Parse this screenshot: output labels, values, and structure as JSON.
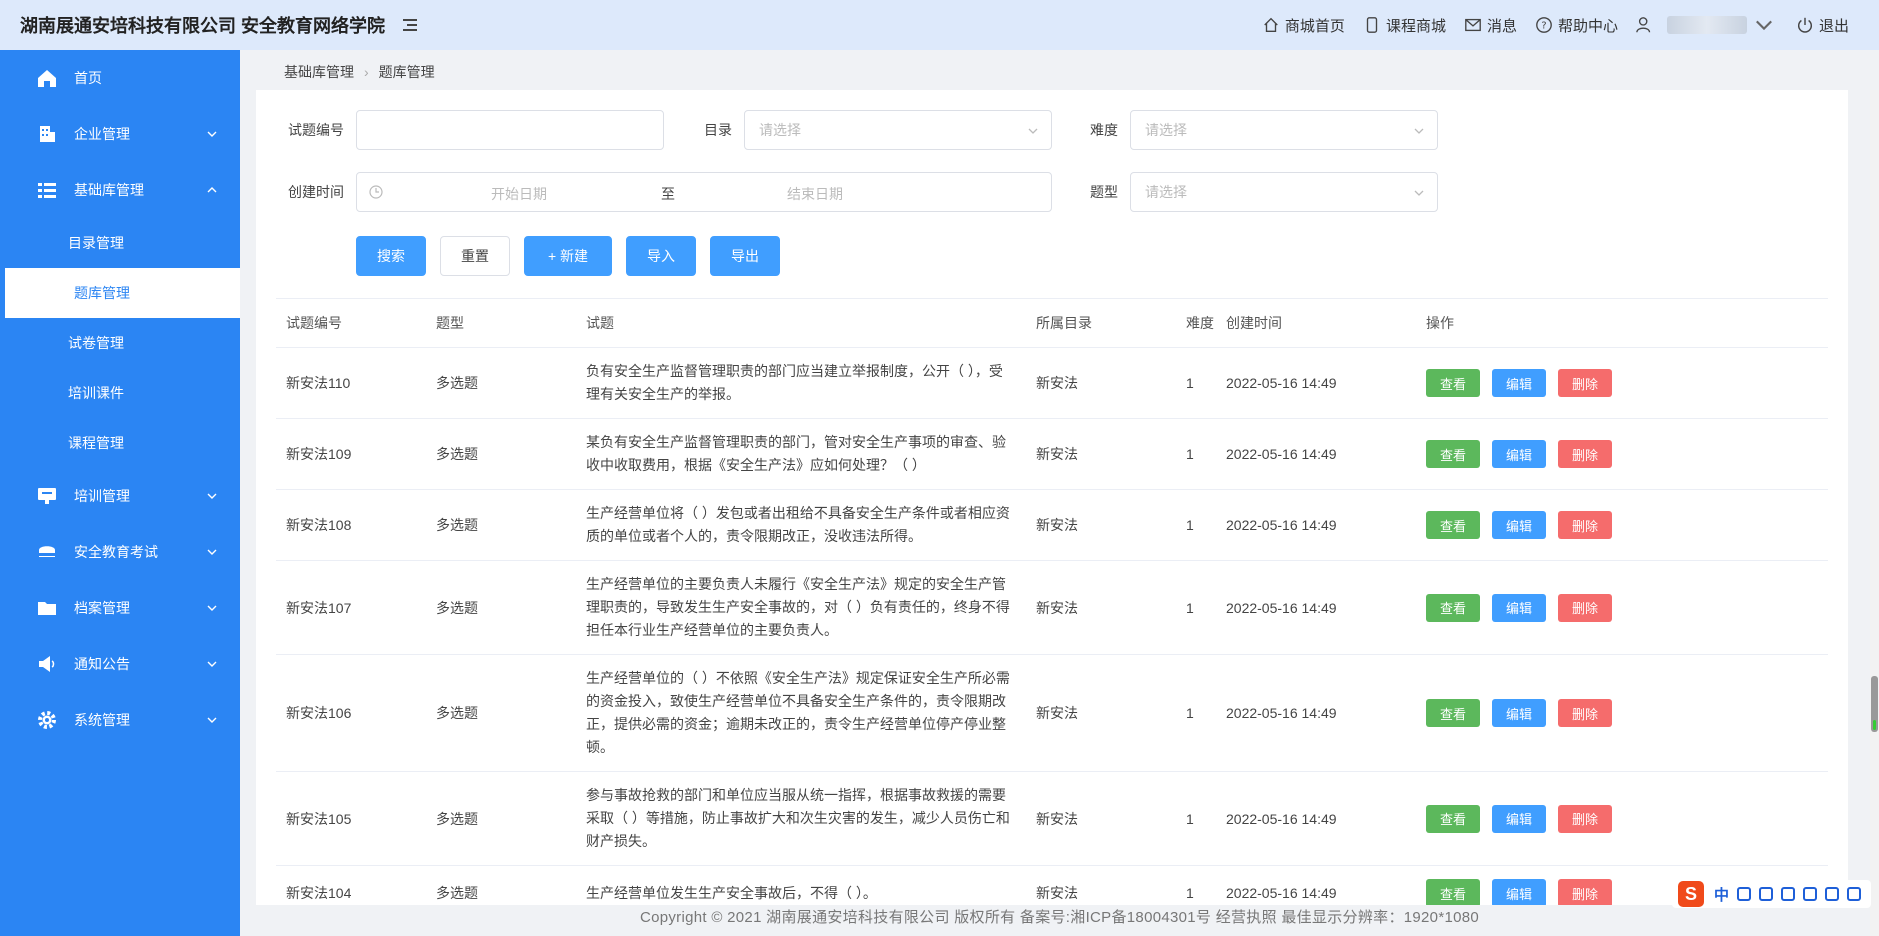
{
  "header": {
    "brand": "湖南展通安培科技有限公司 安全教育网络学院",
    "items": [
      {
        "label": "商城首页",
        "icon": "home-icon"
      },
      {
        "label": "课程商城",
        "icon": "phone-icon"
      },
      {
        "label": "消息",
        "icon": "mail-icon"
      },
      {
        "label": "帮助中心",
        "icon": "help-icon"
      }
    ],
    "logout": "退出"
  },
  "sidebar": {
    "items": [
      {
        "label": "首页",
        "icon": "home-icon"
      },
      {
        "label": "企业管理",
        "icon": "building-icon"
      },
      {
        "label": "基础库管理",
        "icon": "list-icon"
      },
      {
        "label": "培训管理",
        "icon": "screen-icon"
      },
      {
        "label": "安全教育考试",
        "icon": "hat-icon"
      },
      {
        "label": "档案管理",
        "icon": "folder-icon"
      },
      {
        "label": "通知公告",
        "icon": "megaphone-icon"
      },
      {
        "label": "系统管理",
        "icon": "gear-icon"
      }
    ],
    "sub_items": [
      "目录管理",
      "题库管理",
      "试卷管理",
      "培训课件",
      "课程管理"
    ]
  },
  "breadcrumb": {
    "parent": "基础库管理",
    "current": "题库管理"
  },
  "filters": {
    "code_label": "试题编号",
    "catalog_label": "目录",
    "catalog_placeholder": "请选择",
    "difficulty_label": "难度",
    "difficulty_placeholder": "请选择",
    "created_label": "创建时间",
    "start_placeholder": "开始日期",
    "range_sep": "至",
    "end_placeholder": "结束日期",
    "type_label": "题型",
    "type_placeholder": "请选择"
  },
  "buttons": {
    "search": "搜索",
    "reset": "重置",
    "new": "+ 新建",
    "import": "导入",
    "export": "导出"
  },
  "table": {
    "headers": [
      "试题编号",
      "题型",
      "试题",
      "所属目录",
      "难度",
      "创建时间",
      "操作"
    ],
    "actions": {
      "view": "查看",
      "edit": "编辑",
      "delete": "删除"
    },
    "rows": [
      {
        "code": "新安法110",
        "type": "多选题",
        "question": "负有安全生产监督管理职责的部门应当建立举报制度，公开（ ），受理有关安全生产的举报。",
        "catalog": "新安法",
        "difficulty": "1",
        "created": "2022-05-16 14:49"
      },
      {
        "code": "新安法109",
        "type": "多选题",
        "question": "某负有安全生产监督管理职责的部门，管对安全生产事项的审查、验收中收取费用，根据《安全生产法》应如何处理？（ ）",
        "catalog": "新安法",
        "difficulty": "1",
        "created": "2022-05-16 14:49"
      },
      {
        "code": "新安法108",
        "type": "多选题",
        "question": "生产经营单位将（ ）发包或者出租给不具备安全生产条件或者相应资质的单位或者个人的，责令限期改正，没收违法所得。",
        "catalog": "新安法",
        "difficulty": "1",
        "created": "2022-05-16 14:49"
      },
      {
        "code": "新安法107",
        "type": "多选题",
        "question": "生产经营单位的主要负责人未履行《安全生产法》规定的安全生产管理职责的，导致发生生产安全事故的，对（ ）负有责任的，终身不得担任本行业生产经营单位的主要负责人。",
        "catalog": "新安法",
        "difficulty": "1",
        "created": "2022-05-16 14:49"
      },
      {
        "code": "新安法106",
        "type": "多选题",
        "question": "生产经营单位的（ ）不依照《安全生产法》规定保证安全生产所必需的资金投入，致使生产经营单位不具备安全生产条件的，责令限期改正，提供必需的资金；逾期未改正的，责令生产经营单位停产停业整顿。",
        "catalog": "新安法",
        "difficulty": "1",
        "created": "2022-05-16 14:49"
      },
      {
        "code": "新安法105",
        "type": "多选题",
        "question": "参与事故抢救的部门和单位应当服从统一指挥，根据事故救援的需要采取（ ）等措施，防止事故扩大和次生灾害的发生，减少人员伤亡和财产损失。",
        "catalog": "新安法",
        "difficulty": "1",
        "created": "2022-05-16 14:49"
      },
      {
        "code": "新安法104",
        "type": "多选题",
        "question": "生产经营单位发生生产安全事故后，不得（ ）。",
        "catalog": "新安法",
        "difficulty": "1",
        "created": "2022-05-16 14:49"
      }
    ]
  },
  "footer": "Copyright © 2021 湖南展通安培科技有限公司 版权所有 备案号:湘ICP备18004301号 经营执照 最佳显示分辨率：1920*1080",
  "ime": {
    "logo": "S",
    "lang": "中"
  }
}
